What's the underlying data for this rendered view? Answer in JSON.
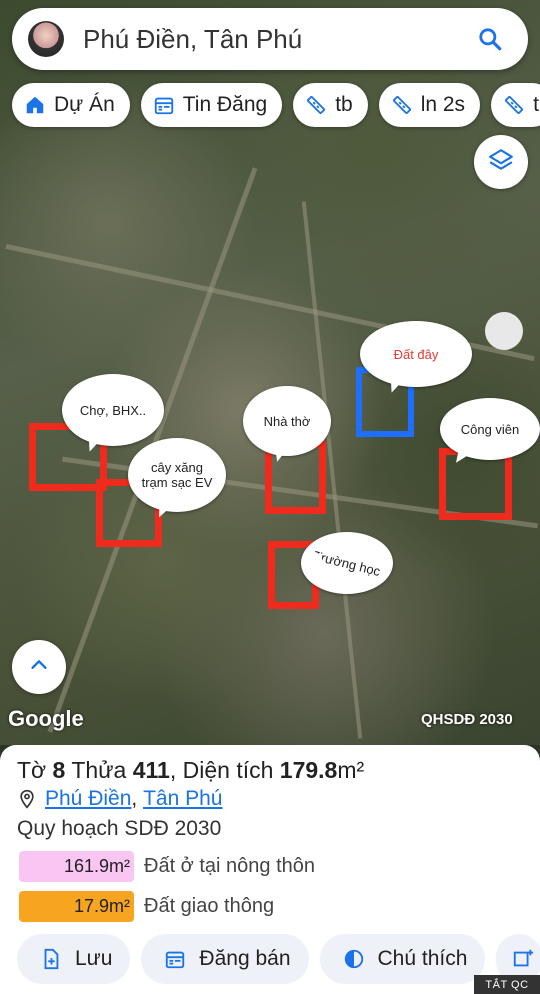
{
  "search": {
    "text": "Phú Điền, Tân Phú"
  },
  "chips": [
    {
      "label": "Dự Án",
      "icon": "home-icon"
    },
    {
      "label": "Tin Đăng",
      "icon": "calendar-icon"
    },
    {
      "label": "tb",
      "icon": "ruler-icon"
    },
    {
      "label": "ln 2s",
      "icon": "ruler-icon"
    },
    {
      "label": "t",
      "icon": "ruler-icon"
    }
  ],
  "map": {
    "bubbles": {
      "cho": "Chợ, BHX..",
      "caixang": "cây xăng\ntrạm sạc EV",
      "nhatho": "Nhà thờ",
      "datday": "Đất đây",
      "congvien": "Công viên",
      "truonghoc": "Trường học"
    },
    "google_logo": "Google",
    "layer_label": "QHSDĐ 2030"
  },
  "parcel": {
    "to_label": "Tờ",
    "to_value": "8",
    "thua_label": "Thửa",
    "thua_value": "411",
    "dientich_label": "Diện tích",
    "dientich_value": "179.8",
    "unit": "m²",
    "commune": "Phú Điền",
    "district": "Tân Phú",
    "plan_title": "Quy hoạch SDĐ 2030",
    "land_uses": [
      {
        "area": "161.9m²",
        "label": "Đất ở tại nông thôn",
        "color": "#f9c6f4"
      },
      {
        "area": "17.9m²",
        "label": "Đất giao thông",
        "color": "#f7a520"
      }
    ]
  },
  "actions": [
    {
      "label": "Lưu",
      "icon": "save-icon"
    },
    {
      "label": "Đăng bán",
      "icon": "calendar-icon"
    },
    {
      "label": "Chú thích",
      "icon": "legend-icon"
    }
  ],
  "ad_tag": "TẮT QC",
  "colors": {
    "accent": "#1a73e8",
    "box_red": "#ee2b1c",
    "box_blue": "#1f6fff"
  }
}
